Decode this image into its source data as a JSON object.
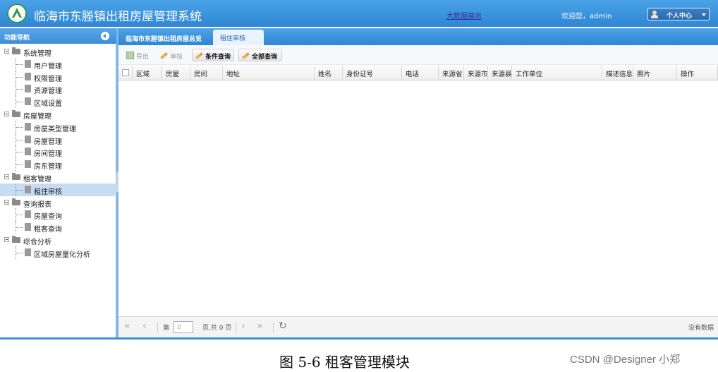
{
  "header": {
    "title": "临海市东塍镇出租房屋管理系统",
    "bigdata_link": "大数据展示",
    "welcome": "欢迎您，admin",
    "user_center": "个人中心"
  },
  "nav": {
    "title": "功能导航",
    "tree": [
      {
        "label": "系统管理",
        "type": "category"
      },
      {
        "label": "用户管理",
        "type": "leaf"
      },
      {
        "label": "权限管理",
        "type": "leaf"
      },
      {
        "label": "资源管理",
        "type": "leaf"
      },
      {
        "label": "区域设置",
        "type": "leaf"
      },
      {
        "label": "房屋管理",
        "type": "category"
      },
      {
        "label": "房屋类型管理",
        "type": "leaf"
      },
      {
        "label": "房屋管理",
        "type": "leaf"
      },
      {
        "label": "房间管理",
        "type": "leaf"
      },
      {
        "label": "房东管理",
        "type": "leaf"
      },
      {
        "label": "租客管理",
        "type": "category"
      },
      {
        "label": "租住审核",
        "type": "leaf",
        "selected": true
      },
      {
        "label": "查询报表",
        "type": "category"
      },
      {
        "label": "房屋查询",
        "type": "leaf"
      },
      {
        "label": "租客查询",
        "type": "leaf"
      },
      {
        "label": "综合分析",
        "type": "category"
      },
      {
        "label": "区域房屋量化分析",
        "type": "leaf"
      }
    ]
  },
  "tabs": [
    {
      "label": "临海市东塍镇出租房屋总览"
    },
    {
      "label": "租住审核",
      "active": true
    }
  ],
  "toolbar": {
    "export": "导出",
    "audit": "审核",
    "conditional_query": "条件查询",
    "query_all": "全部查询"
  },
  "grid": {
    "columns": [
      "区域",
      "房屋",
      "房间",
      "地址",
      "姓名",
      "身份证号",
      "电话",
      "来源省",
      "来源市",
      "来源县",
      "工作单位",
      "描述信息",
      "照片",
      "操作"
    ]
  },
  "pager": {
    "page_prefix": "第",
    "page_value": "0",
    "page_total": "页,共 0 页",
    "no_data": "没有数据"
  },
  "caption": "图  5-6 租客管理模块",
  "watermark": "CSDN @Designer 小郑"
}
